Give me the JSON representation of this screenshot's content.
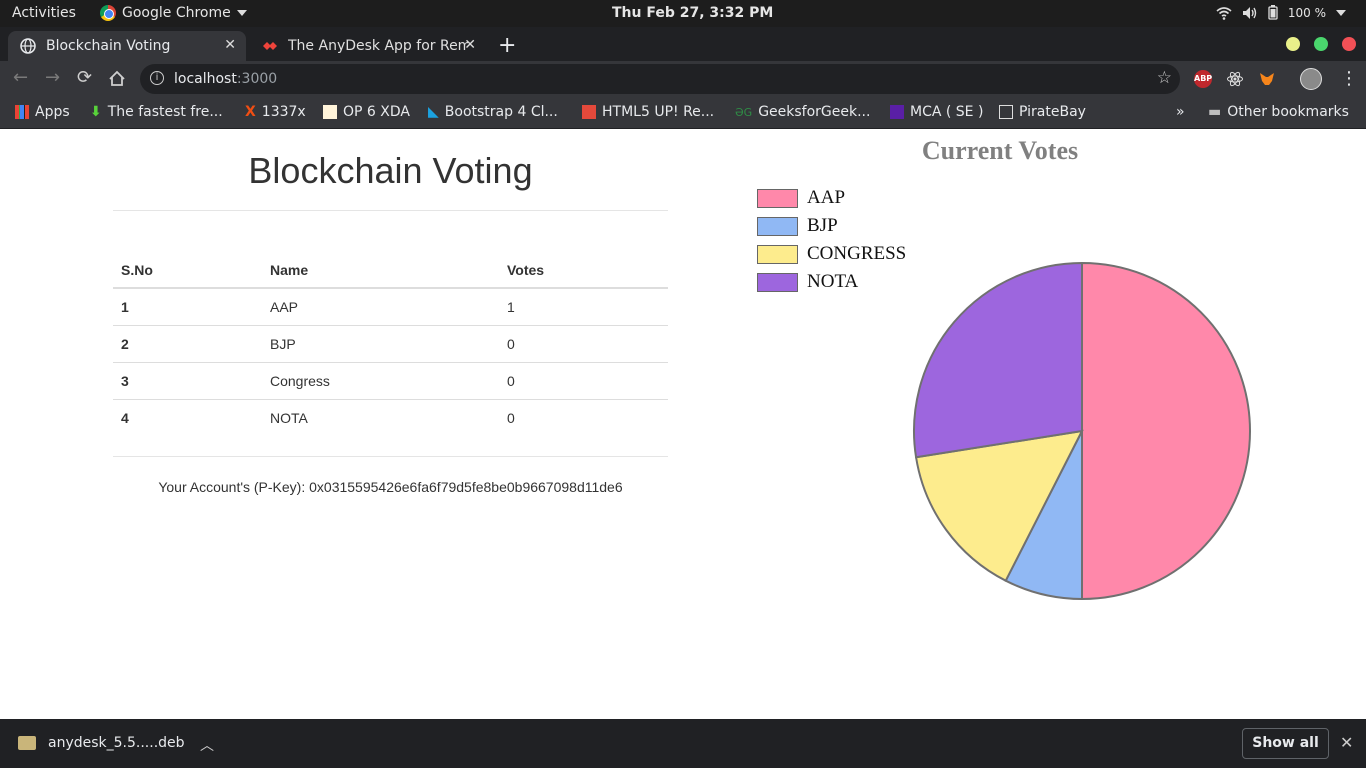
{
  "topbar": {
    "activities": "Activities",
    "app_name": "Google Chrome",
    "clock": "Thu Feb 27,  3:32 PM",
    "battery": "100 %"
  },
  "tabs": [
    {
      "title": "Blockchain Voting",
      "active": true
    },
    {
      "title": "The AnyDesk App for Rem",
      "active": false
    }
  ],
  "address_bar": {
    "host": "localhost",
    "port": ":3000"
  },
  "bookmarks": [
    {
      "label": "Apps"
    },
    {
      "label": "The fastest fre..."
    },
    {
      "label": "1337x"
    },
    {
      "label": "OP 6 XDA"
    },
    {
      "label": "Bootstrap 4 Cl..."
    },
    {
      "label": "HTML5 UP! Re..."
    },
    {
      "label": "GeeksforGeek..."
    },
    {
      "label": "MCA ( SE )"
    },
    {
      "label": "PirateBay"
    },
    {
      "label": "Other bookmarks"
    }
  ],
  "page": {
    "heading": "Blockchain Voting",
    "table": {
      "headers": [
        "S.No",
        "Name",
        "Votes"
      ],
      "rows": [
        [
          "1",
          "AAP",
          "1"
        ],
        [
          "2",
          "BJP",
          "0"
        ],
        [
          "3",
          "Congress",
          "0"
        ],
        [
          "4",
          "NOTA",
          "0"
        ]
      ]
    },
    "account": "Your Account's (P-Key): 0x0315595426e6fa6f79d5fe8be0b9667098d11de6"
  },
  "chart_data": {
    "type": "pie",
    "title": "Current Votes",
    "categories": [
      "AAP",
      "BJP",
      "CONGRESS",
      "NOTA"
    ],
    "values": [
      50,
      7.5,
      15,
      27.5
    ],
    "colors": [
      "#ff88aa",
      "#90b8f4",
      "#fdec8d",
      "#9d66de"
    ],
    "legend": "top-left"
  },
  "downloads": {
    "file": "anydesk_5.5.....deb",
    "show_all": "Show all"
  },
  "colors": {
    "topbar": "#1d1d1d",
    "tabstrip": "#202124",
    "toolbar": "#35363a"
  }
}
